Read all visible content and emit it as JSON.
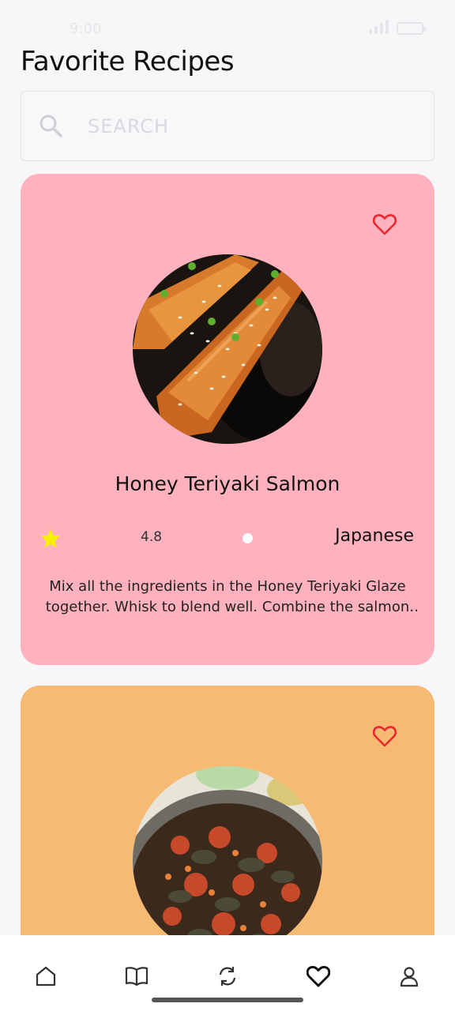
{
  "status_bar": {
    "time": "9:00"
  },
  "header": {
    "title": "Favorite Recipes"
  },
  "search": {
    "placeholder": "SEARCH"
  },
  "recipes": [
    {
      "title": "Honey Teriyaki Salmon",
      "rating": "4.8",
      "cuisine": "Japanese",
      "description": "Mix all the ingredients in the Honey Teriyaki Glaze together. Whisk to blend well. Combine the salmon and the marinade",
      "color": "#ffb1bd",
      "favorite_icon": "heart-outline-icon"
    },
    {
      "title": "",
      "color": "#f7ba73",
      "favorite_icon": "heart-outline-icon"
    }
  ],
  "nav": {
    "items": [
      {
        "icon": "home-icon"
      },
      {
        "icon": "book-icon"
      },
      {
        "icon": "refresh-icon"
      },
      {
        "icon": "heart-icon",
        "active": true
      },
      {
        "icon": "profile-icon"
      }
    ]
  },
  "colors": {
    "accent_heart": "#e8272e",
    "star": "#f4f000"
  }
}
